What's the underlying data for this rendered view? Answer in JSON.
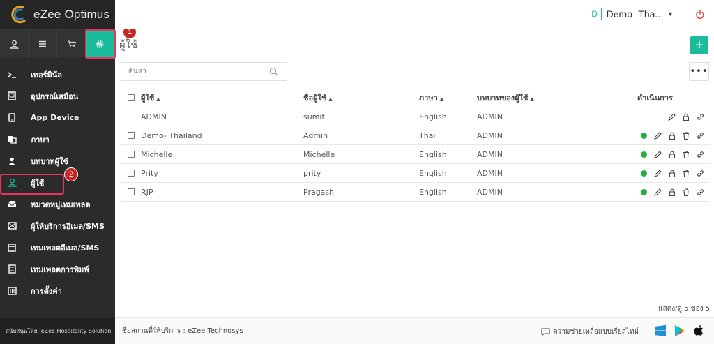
{
  "app": {
    "name": "eZee Optimus",
    "property": {
      "badge": "D",
      "name": "Demo- Tha..."
    }
  },
  "sidebar": {
    "top_icons": [
      "user-icon",
      "menu-icon",
      "cart-icon",
      "gear-icon"
    ],
    "items": [
      {
        "label": "เทอร์มินัล",
        "icon": "terminal-icon"
      },
      {
        "label": "อุปกรณ์เสมือน",
        "icon": "device-icon"
      },
      {
        "label": "App Device",
        "icon": "mobile-icon"
      },
      {
        "label": "ภาษา",
        "icon": "language-icon"
      },
      {
        "label": "บทบาทผู้ใช้",
        "icon": "role-icon"
      },
      {
        "label": "ผู้ใช้",
        "icon": "user-icon",
        "active": true
      },
      {
        "label": "หมวดหมู่เทมเพลต",
        "icon": "inbox-icon"
      },
      {
        "label": "ผู้ให้บริการอีเมล/SMS",
        "icon": "envelope-icon"
      },
      {
        "label": "เทมเพลตอีเมล/SMS",
        "icon": "calendar-icon"
      },
      {
        "label": "เทมเพลตการพิมพ์",
        "icon": "document-icon"
      },
      {
        "label": "การตั้งค่า",
        "icon": "settings-panel-icon"
      }
    ],
    "footer": "สนับสนุนโดย: eZee Hospitality Solution"
  },
  "annotations": {
    "first": "1",
    "second": "2"
  },
  "main": {
    "title": "ผู้ใช้",
    "add_label": "+",
    "more_label": "•••",
    "search_placeholder": "ค้นหา",
    "columns": {
      "user": "ผู้ใช้",
      "username": "ชื่อผู้ใช้",
      "language": "ภาษา",
      "role": "บทบาทของผู้ใช้",
      "actions": "ดำเนินการ"
    },
    "rows": [
      {
        "user": "ADMIN",
        "username": "sumit",
        "language": "English",
        "role": "ADMIN",
        "checkbox": false,
        "status": false,
        "delete": false
      },
      {
        "user": "Demo- Thailand",
        "username": "Admin",
        "language": "Thai",
        "role": "ADMIN",
        "checkbox": true,
        "status": true,
        "delete": true
      },
      {
        "user": "Michelle",
        "username": "Michelle",
        "language": "English",
        "role": "ADMIN",
        "checkbox": true,
        "status": true,
        "delete": true
      },
      {
        "user": "Prity",
        "username": "prity",
        "language": "English",
        "role": "ADMIN",
        "checkbox": true,
        "status": true,
        "delete": true
      },
      {
        "user": "RJP",
        "username": "Pragash",
        "language": "English",
        "role": "ADMIN",
        "checkbox": true,
        "status": true,
        "delete": true
      }
    ],
    "pagination": "แสดง/ดู 5 ของ 5"
  },
  "footer": {
    "provider": "ชื่อสถานที่ให้บริการ : eZee Technosys",
    "support": "ความช่วยเหลือแบบเรียลไทม์"
  },
  "colors": {
    "accent": "#1abc9c",
    "highlight": "#e8355c",
    "badge": "#c62828",
    "status_active": "#27ae3c",
    "sidebar_bg": "#2b2b2b"
  }
}
